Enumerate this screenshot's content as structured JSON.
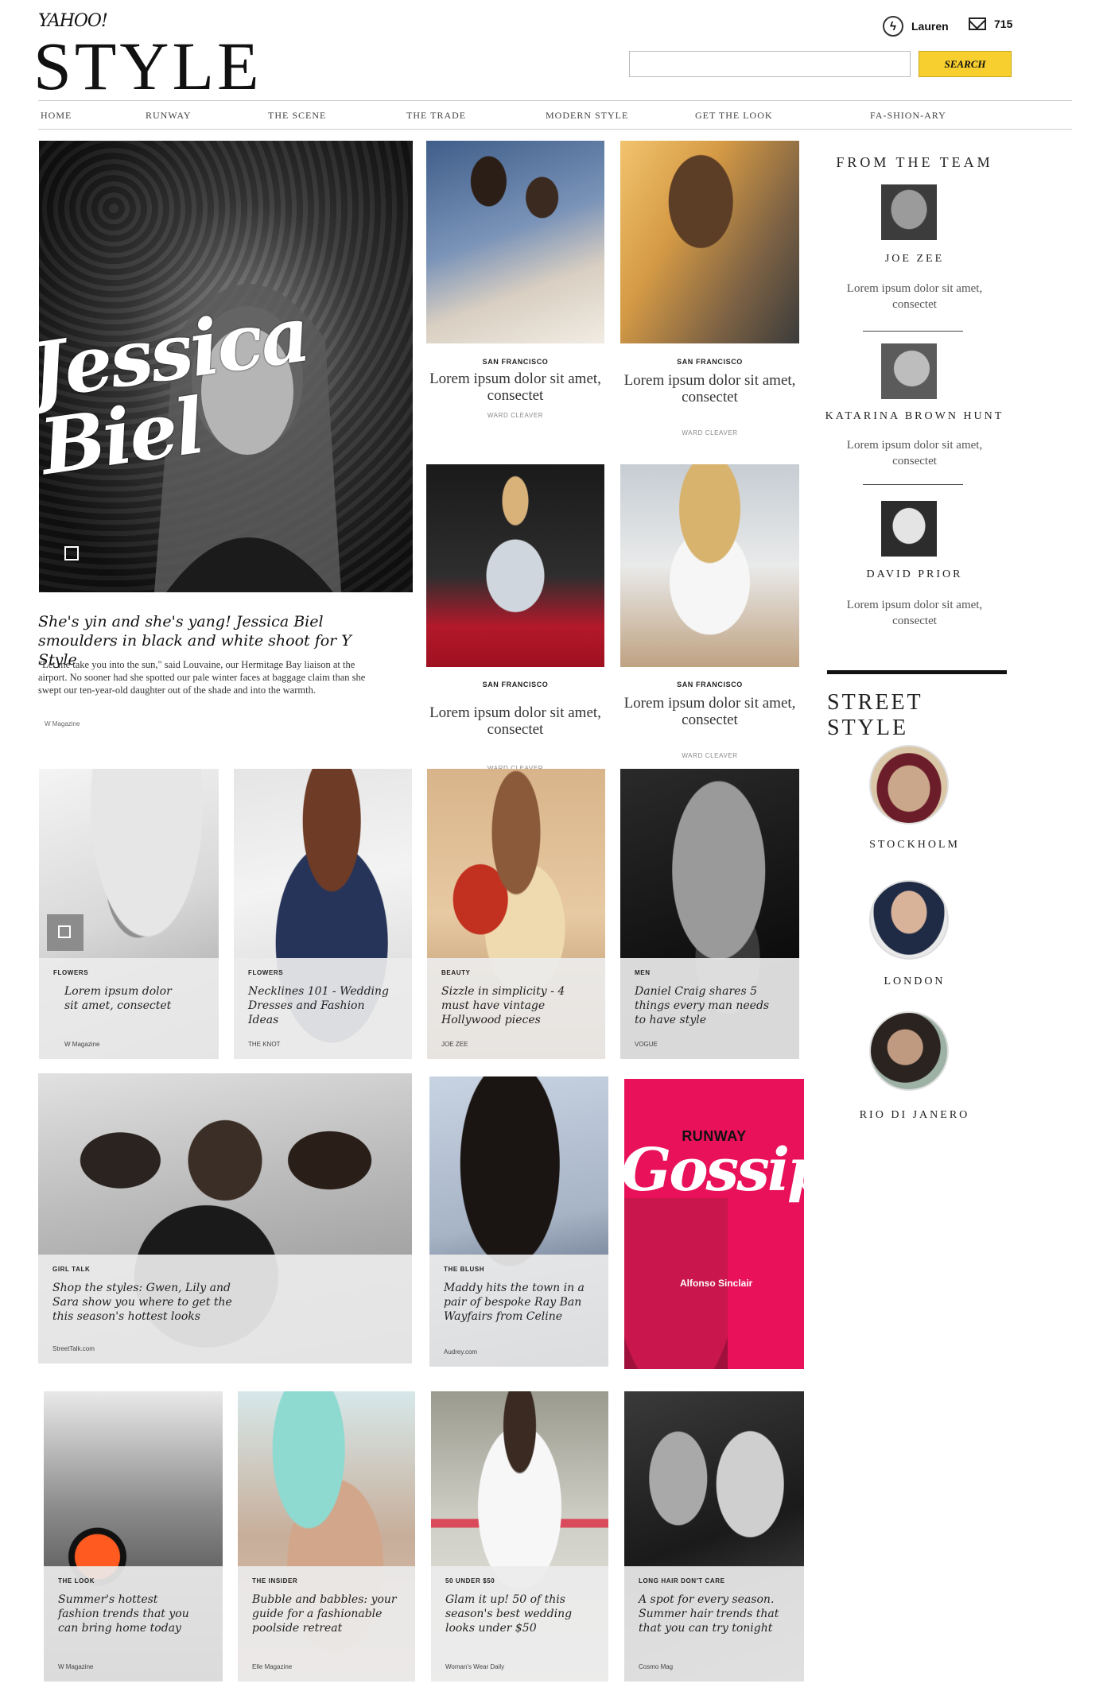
{
  "header": {
    "yahoo": "YAHOO!",
    "logo": "STYLE",
    "user_name": "Lauren",
    "mail_count": "715",
    "search_placeholder": "",
    "search_label": "SEARCH"
  },
  "nav": [
    "HOME",
    "RUNWAY",
    "THE SCENE",
    "THE TRADE",
    "MODERN STYLE",
    "GET THE LOOK",
    "FA-SHION-ARY"
  ],
  "hero": {
    "title": "She's yin and she's yang! Jessica Biel smoulders in black and white shoot for Y Style",
    "body": "\"Let me take you into the sun,\" said Louvaine, our Hermitage Bay liaison at the airport. No sooner had she spotted our pale winter faces at baggage claim than she swept our ten-year-old daughter out of the shade and into the warmth.",
    "source": "W Magazine",
    "overlay_text": "Jessica Biel"
  },
  "small_cards": [
    {
      "tag": "SAN FRANCISCO",
      "title": "Lorem ipsum dolor sit amet, consectet",
      "credit": "WARD CLEAVER"
    },
    {
      "tag": "SAN FRANCISCO",
      "title": "Lorem ipsum dolor sit amet, consectet",
      "credit": "WARD CLEAVER"
    },
    {
      "tag": "SAN FRANCISCO",
      "title": "Lorem ipsum dolor sit amet, consectet",
      "credit": "WARD CLEAVER"
    },
    {
      "tag": "SAN FRANCISCO",
      "title": "Lorem ipsum dolor sit amet, consectet",
      "credit": "WARD CLEAVER"
    }
  ],
  "row3": [
    {
      "kicker": "FLOWERS",
      "title": "Lorem ipsum dolor sit amet, consectet",
      "source": "W Magazine"
    },
    {
      "kicker": "FLOWERS",
      "title": "Necklines 101 - Wedding Dresses and Fashion Ideas",
      "source": "THE KNOT"
    },
    {
      "kicker": "BEAUTY",
      "title": "Sizzle in simplicity - 4 must have vintage Hollywood pieces",
      "source": "JOE ZEE"
    },
    {
      "kicker": "MEN",
      "title": "Daniel Craig shares 5 things every man needs to have style",
      "source": "VOGUE"
    }
  ],
  "row4": [
    {
      "kicker": "GIRL TALK",
      "title": "Shop the styles: Gwen, Lily and Sara show you where to get the this season's hottest looks",
      "source": "StreetTalk.com"
    },
    {
      "kicker": "THE BLUSH",
      "title": "Maddy hits the town in a pair of bespoke Ray Ban Wayfairs from Celine",
      "source": "Audrey.com"
    }
  ],
  "gossip": {
    "label": "RUNWAY",
    "word": "Gossip",
    "name": "Alfonso Sinclair"
  },
  "row5": [
    {
      "kicker": "THE LOOK",
      "title": "Summer's hottest fashion trends that you can bring home today",
      "source": "W Magazine"
    },
    {
      "kicker": "THE INSIDER",
      "title": "Bubble and babbles: your guide for a fashionable poolside retreat",
      "source": "Elle Magazine"
    },
    {
      "kicker": "50 UNDER $50",
      "title": "Glam it up! 50 of this season's best wedding looks under $50",
      "source": "Woman's Wear Daily"
    },
    {
      "kicker": "LONG HAIR DON'T CARE",
      "title": "A spot for every season. Summer hair trends that that you can try tonight",
      "source": "Cosmo Mag"
    }
  ],
  "sidebar": {
    "team_heading": "FROM THE TEAM",
    "team": [
      {
        "name": "JOE ZEE",
        "text": "Lorem ipsum dolor sit amet, consectet"
      },
      {
        "name": "KATARINA BROWN HUNT",
        "text": "Lorem ipsum dolor sit amet, consectet"
      },
      {
        "name": "DAVID PRIOR",
        "text": "Lorem ipsum dolor sit amet, consectet"
      }
    ],
    "street_heading": "STREET STYLE",
    "cities": [
      "STOCKHOLM",
      "LONDON",
      "RIO DI JANERO"
    ]
  },
  "colors": {
    "accent": "#f7cf2e",
    "gossip": "#e8115a"
  }
}
